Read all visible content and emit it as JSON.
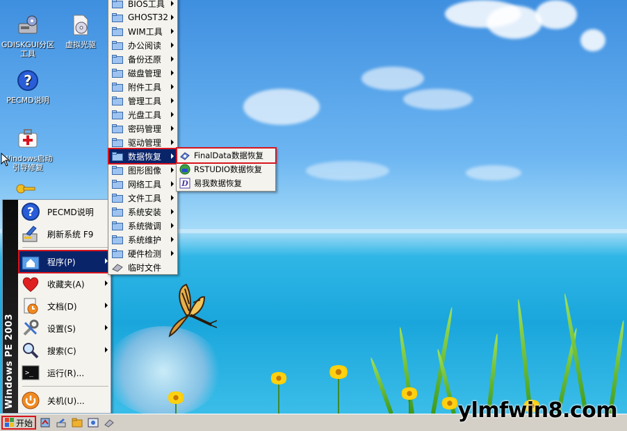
{
  "desktop_icons": [
    {
      "label": "GDISKGUI分区\n工具",
      "icon": "disk-partition-icon"
    },
    {
      "label": "虚拟光驱",
      "icon": "virtual-cd-icon"
    },
    {
      "label": "PECMD说明",
      "icon": "help-icon"
    },
    {
      "label": "Windows启动\n引导修复",
      "icon": "first-aid-icon"
    }
  ],
  "start_menu": {
    "band_text": "Windows PE 2003",
    "items": [
      {
        "label": "PECMD说明",
        "icon": "help-icon",
        "submenu": false
      },
      {
        "label": "刷新系统 F9",
        "icon": "refresh-icon",
        "submenu": false
      },
      {
        "label": "程序(P)",
        "icon": "programs-icon",
        "submenu": true,
        "active": true
      },
      {
        "label": "收藏夹(A)",
        "icon": "favorites-icon",
        "submenu": true
      },
      {
        "label": "文档(D)",
        "icon": "documents-icon",
        "submenu": true
      },
      {
        "label": "设置(S)",
        "icon": "settings-icon",
        "submenu": true
      },
      {
        "label": "搜索(C)",
        "icon": "search-icon",
        "submenu": true
      },
      {
        "label": "运行(R)...",
        "icon": "run-icon",
        "submenu": false
      },
      {
        "label": "关机(U)...",
        "icon": "shutdown-icon",
        "submenu": false
      }
    ]
  },
  "programs_menu": {
    "items": [
      "BIOS工具",
      "GHOST32",
      "WIM工具",
      "办公阅读",
      "备份还原",
      "磁盘管理",
      "附件工具",
      "管理工具",
      "光盘工具",
      "密码管理",
      "驱动管理",
      "数据恢复",
      "图形图像",
      "网络工具",
      "文件工具",
      "系统安装",
      "系统微调",
      "系统维护",
      "硬件检测",
      "临时文件"
    ],
    "active_index": 11
  },
  "recovery_menu": {
    "items": [
      {
        "label": "FinalData数据恢复",
        "icon": "finaldata-icon"
      },
      {
        "label": "RSTUDIO数据恢复",
        "icon": "rstudio-icon"
      },
      {
        "label": "易我数据恢复",
        "icon": "easeus-icon"
      }
    ]
  },
  "taskbar": {
    "start_label": "开始",
    "quick_launch": [
      "explorer-icon",
      "tools-icon",
      "folder-icon",
      "picture-icon",
      "eraser-icon"
    ]
  },
  "watermark": "ylmfwin8.com",
  "colors": {
    "menu_bg": "#f4f3ee",
    "highlight": "#0a246a",
    "callout_red": "#d8141e",
    "taskbar": "#d4d0c8"
  }
}
